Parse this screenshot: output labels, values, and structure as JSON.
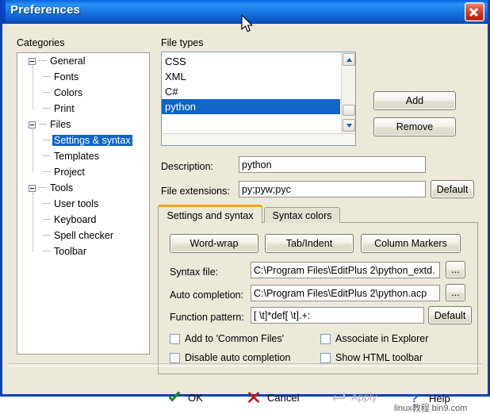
{
  "window": {
    "title": "Preferences",
    "close_icon": "close-icon",
    "accent_titlebar": "#1276ea",
    "dialog_bg": "#ece9d8",
    "selection_blue": "#1264c8",
    "tab_accent": "#f0a216"
  },
  "categories": {
    "label": "Categories",
    "tree": [
      {
        "label": "General",
        "level": 0,
        "expander": "collapse-icon",
        "selected": false
      },
      {
        "label": "Fonts",
        "level": 1,
        "expander": null,
        "selected": false
      },
      {
        "label": "Colors",
        "level": 1,
        "expander": null,
        "selected": false
      },
      {
        "label": "Print",
        "level": 1,
        "expander": null,
        "selected": false
      },
      {
        "label": "Files",
        "level": 0,
        "expander": "collapse-icon",
        "selected": false
      },
      {
        "label": "Settings & syntax",
        "level": 1,
        "expander": null,
        "selected": true
      },
      {
        "label": "Templates",
        "level": 1,
        "expander": null,
        "selected": false
      },
      {
        "label": "Project",
        "level": 1,
        "expander": null,
        "selected": false
      },
      {
        "label": "Tools",
        "level": 0,
        "expander": "collapse-icon",
        "selected": false
      },
      {
        "label": "User tools",
        "level": 1,
        "expander": null,
        "selected": false
      },
      {
        "label": "Keyboard",
        "level": 1,
        "expander": null,
        "selected": false
      },
      {
        "label": "Spell checker",
        "level": 1,
        "expander": null,
        "selected": false
      },
      {
        "label": "Toolbar",
        "level": 1,
        "expander": null,
        "selected": false
      }
    ]
  },
  "file_types": {
    "label": "File types",
    "items": [
      {
        "label": "CSS",
        "selected": false
      },
      {
        "label": "XML",
        "selected": false
      },
      {
        "label": "C#",
        "selected": false
      },
      {
        "label": "python",
        "selected": true
      }
    ],
    "scroll_up_icon": "chevron-up-icon",
    "scroll_down_icon": "chevron-down-icon"
  },
  "side_buttons": {
    "add_label": "Add",
    "remove_label": "Remove"
  },
  "fields": {
    "description_label": "Description:",
    "description_value": "python",
    "extensions_label": "File extensions:",
    "extensions_value": "py;pyw;pyc",
    "extensions_default_label": "Default"
  },
  "tabs": [
    {
      "label": "Settings and syntax",
      "active": true
    },
    {
      "label": "Syntax colors",
      "active": false
    }
  ],
  "settings_panel": {
    "buttons": [
      {
        "label": "Word-wrap"
      },
      {
        "label": "Tab/Indent"
      },
      {
        "label": "Column Markers"
      }
    ],
    "syntax_file_label": "Syntax file:",
    "syntax_file_value": "C:\\Program Files\\EditPlus 2\\python_extd.",
    "syntax_file_browse_label": "...",
    "auto_completion_label": "Auto completion:",
    "auto_completion_value": "C:\\Program Files\\EditPlus 2\\python.acp",
    "auto_completion_browse_label": "...",
    "function_pattern_label": "Function pattern:",
    "function_pattern_value": "[ \\t]*def[ \\t].+:",
    "function_pattern_default_label": "Default",
    "checkboxes": [
      {
        "label": "Add to 'Common Files'",
        "checked": false
      },
      {
        "label": "Associate in Explorer",
        "checked": false
      },
      {
        "label": "Disable auto completion",
        "checked": false
      },
      {
        "label": "Show HTML toolbar",
        "checked": false
      }
    ]
  },
  "footer": {
    "ok_label": "OK",
    "ok_icon": "checkmark-icon",
    "cancel_label": "Cancel",
    "cancel_icon": "cross-icon",
    "apply_label": "Apply",
    "apply_icon": "enter-arrow-icon",
    "apply_disabled": true,
    "help_label": "Help",
    "help_icon": "question-mark-icon"
  },
  "watermark": {
    "text": "linux教程 bin9.com"
  }
}
